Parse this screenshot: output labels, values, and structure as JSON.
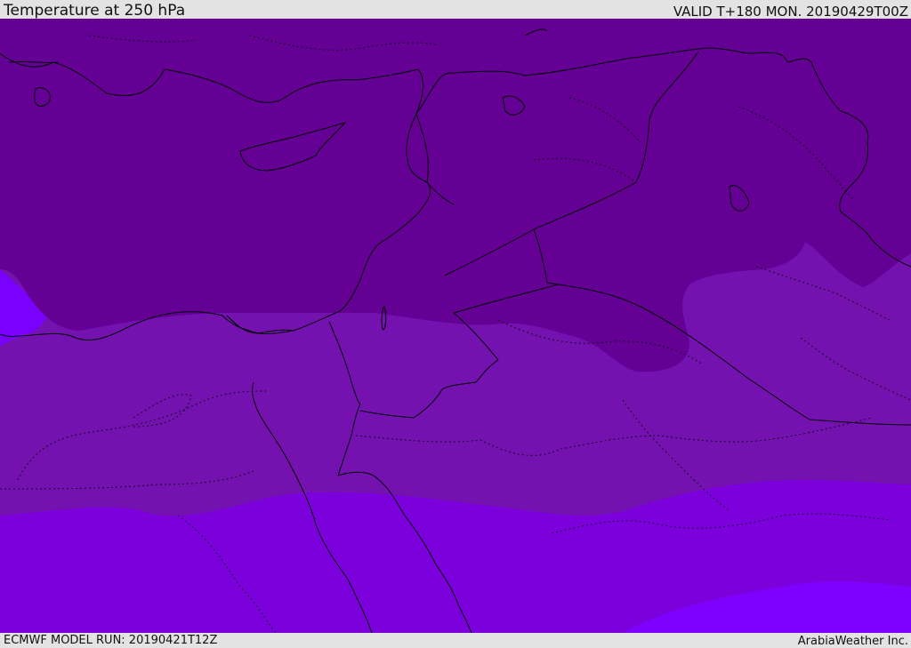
{
  "header": {
    "title": "Temperature at 250 hPa",
    "valid_time": "VALID T+180 MON. 20190429T00Z"
  },
  "footer": {
    "model_run": "ECMWF MODEL RUN: 20190421T12Z",
    "credit": "ArabiaWeather Inc."
  },
  "map": {
    "colors": {
      "coldest_band": "#640094",
      "cold_band": "#7412b0",
      "mid_band": "#7c00dc",
      "warm_band": "#7a00ff",
      "coastline": "#000000",
      "border": "#000000"
    }
  }
}
